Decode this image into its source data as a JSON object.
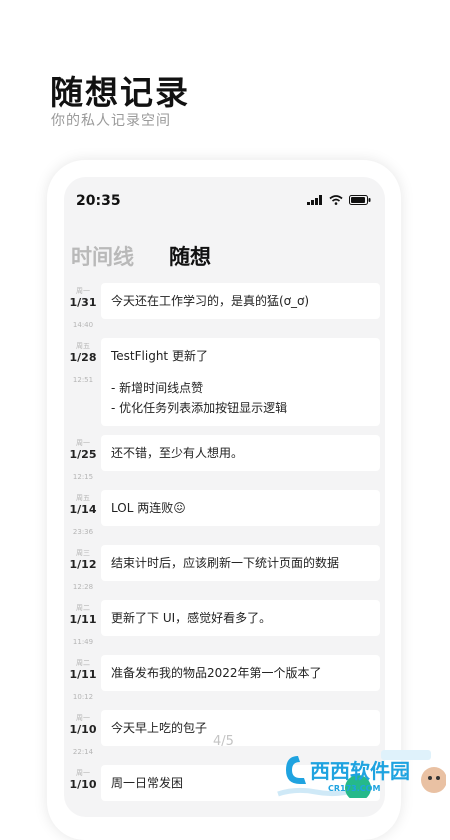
{
  "hero": {
    "title": "随想记录",
    "subtitle": "你的私人记录空间"
  },
  "status_bar": {
    "time": "20:35",
    "icons": [
      "signal-icon",
      "wifi-icon",
      "battery-icon"
    ]
  },
  "tabs": [
    {
      "label": "时间线",
      "active": false
    },
    {
      "label": "随想",
      "active": true
    }
  ],
  "entries": [
    {
      "dow": "周一",
      "date": "1/31",
      "time": "14:40",
      "lines": [
        "今天还在工作学习的，是真的猛(ơ_ơ)"
      ]
    },
    {
      "dow": "周五",
      "date": "1/28",
      "time": "12:51",
      "lines": [
        "TestFlight 更新了",
        "",
        "- 新增时间线点赞",
        "- 优化任务列表添加按钮显示逻辑"
      ]
    },
    {
      "dow": "周一",
      "date": "1/25",
      "time": "12:15",
      "lines": [
        "还不错，至少有人想用。"
      ]
    },
    {
      "dow": "周五",
      "date": "1/14",
      "time": "23:36",
      "lines": [
        "LOL 两连败😖"
      ]
    },
    {
      "dow": "周三",
      "date": "1/12",
      "time": "12:28",
      "lines": [
        "结束计时后，应该刷新一下统计页面的数据"
      ]
    },
    {
      "dow": "周二",
      "date": "1/11",
      "time": "11:49",
      "lines": [
        "更新了下 UI，感觉好看多了。"
      ]
    },
    {
      "dow": "周二",
      "date": "1/11",
      "time": "10:12",
      "lines": [
        "准备发布我的物品2022年第一个版本了"
      ]
    },
    {
      "dow": "周一",
      "date": "1/10",
      "time": "22:14",
      "lines": [
        "今天早上吃的包子"
      ]
    },
    {
      "dow": "周一",
      "date": "1/10",
      "time": "",
      "lines": [
        "周一日常发困"
      ]
    }
  ],
  "pager": "4/5",
  "watermark": {
    "brand": "西西软件园",
    "domain": "CR173.COM",
    "colors": {
      "primary": "#1fa3e0",
      "accent": "#25b98a"
    }
  }
}
